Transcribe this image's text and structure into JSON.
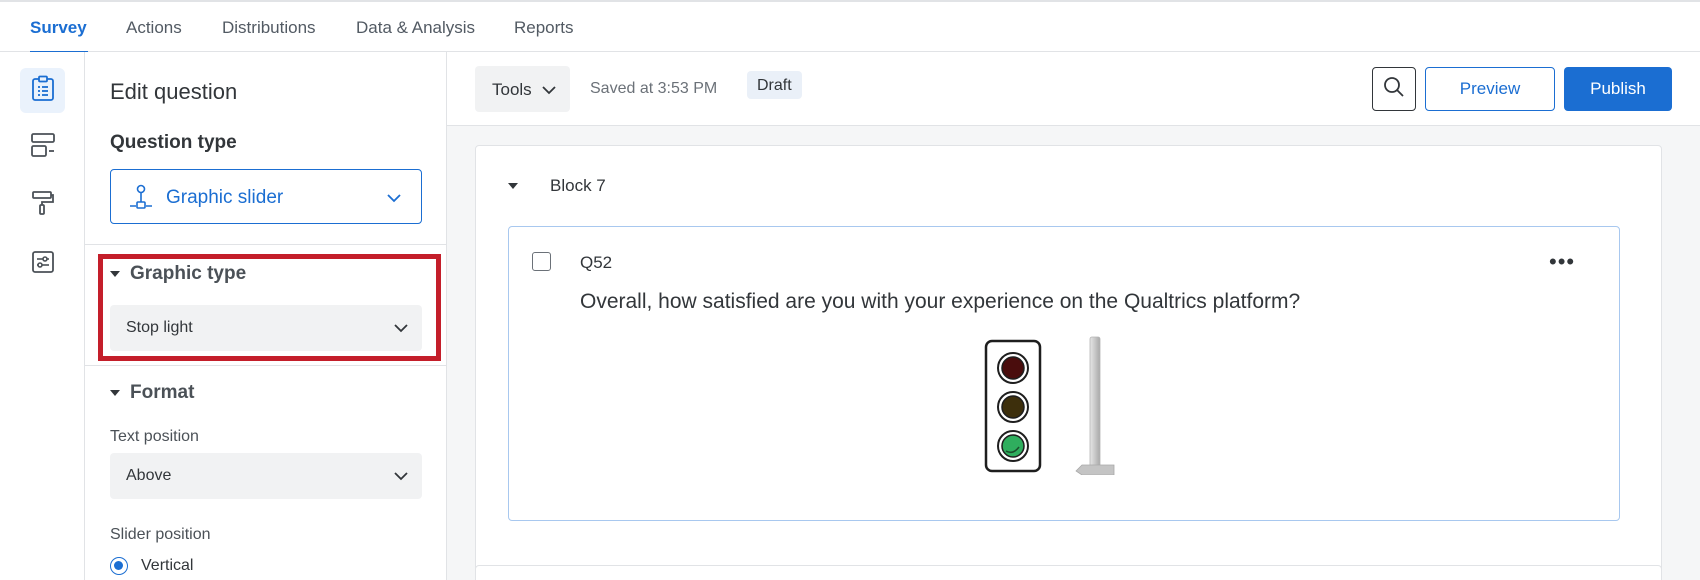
{
  "nav": {
    "tabs": [
      {
        "label": "Survey",
        "active": true
      },
      {
        "label": "Actions",
        "active": false
      },
      {
        "label": "Distributions",
        "active": false
      },
      {
        "label": "Data & Analysis",
        "active": false
      },
      {
        "label": "Reports",
        "active": false
      }
    ]
  },
  "rail": {
    "items": [
      {
        "icon": "clipboard-icon",
        "active": true
      },
      {
        "icon": "layout-icon",
        "active": false
      },
      {
        "icon": "paint-roller-icon",
        "active": false
      },
      {
        "icon": "settings-sliders-icon",
        "active": false
      }
    ]
  },
  "panel": {
    "title": "Edit question",
    "question_type_label": "Question type",
    "question_type_value": "Graphic slider",
    "graphic_type_label": "Graphic type",
    "graphic_type_value": "Stop light",
    "format_label": "Format",
    "text_position_label": "Text position",
    "text_position_value": "Above",
    "slider_position_label": "Slider position",
    "slider_position_option": "Vertical"
  },
  "toolbar": {
    "tools_label": "Tools",
    "saved_text": "Saved at 3:53 PM",
    "draft_label": "Draft",
    "preview_label": "Preview",
    "publish_label": "Publish"
  },
  "block": {
    "title": "Block 7",
    "question": {
      "id": "Q52",
      "text": "Overall, how satisfied are you with your experience on the Qualtrics platform?",
      "more": "•••"
    }
  },
  "colors": {
    "accent": "#1b6ed2",
    "highlight": "#c41e2a"
  }
}
